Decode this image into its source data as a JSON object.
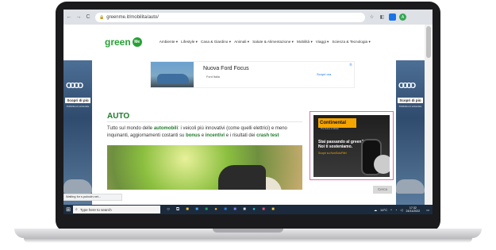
{
  "browser": {
    "url": "greenme.it/mobilita/auto/",
    "nav": {
      "back": "←",
      "forward": "→",
      "reload": "C"
    },
    "lock_icon": "🔒",
    "extensions": [
      "☆",
      "◧"
    ],
    "profile_initial": "A"
  },
  "site": {
    "logo": "green",
    "logo_badge": "Me",
    "menu": [
      "Ambiente ▾",
      "Lifestyle ▾",
      "Casa & Giardino ▾",
      "Animali ▾",
      "Salute & Alimentazione ▾",
      "Mobilità ▾",
      "Viaggi ▾",
      "Scienza & Tecnologia ▾"
    ]
  },
  "ads": {
    "side_button": "Scopri di più",
    "side_tiny": "Pubblicità con ambientale",
    "top_ad": {
      "title": "Nuova Ford Focus",
      "subtitle": "Ford Italia",
      "cta": "Scopri ora",
      "badge": "Ⓓ"
    },
    "continental": {
      "logo": "Continental",
      "tag": "The Future in Motion",
      "headline": "Stai passando al green? Noi ti sosteniamo.",
      "link": "Scopri su NonSoloFiltri"
    },
    "search_button": "Cerca"
  },
  "article": {
    "heading": "AUTO",
    "intro_parts": [
      "Tutto sul mondo delle ",
      "automobili",
      ": i veicoli più innovativi (come quelli elettrici) e meno inquinanti, aggiornamenti costanti su ",
      "bonus",
      " e ",
      "incentivi",
      " e i risultati dei ",
      "crash test"
    ]
  },
  "status_text": "Waiting for s.pubcdn.net...",
  "taskbar": {
    "search_placeholder": "Type here to search",
    "weather": "14°C",
    "time": "17:32",
    "date": "24/11/2022"
  },
  "colors": {
    "brand_green": "#27a136",
    "heading_green": "#1d7b2a",
    "taskbar": "#1b2b3d"
  }
}
